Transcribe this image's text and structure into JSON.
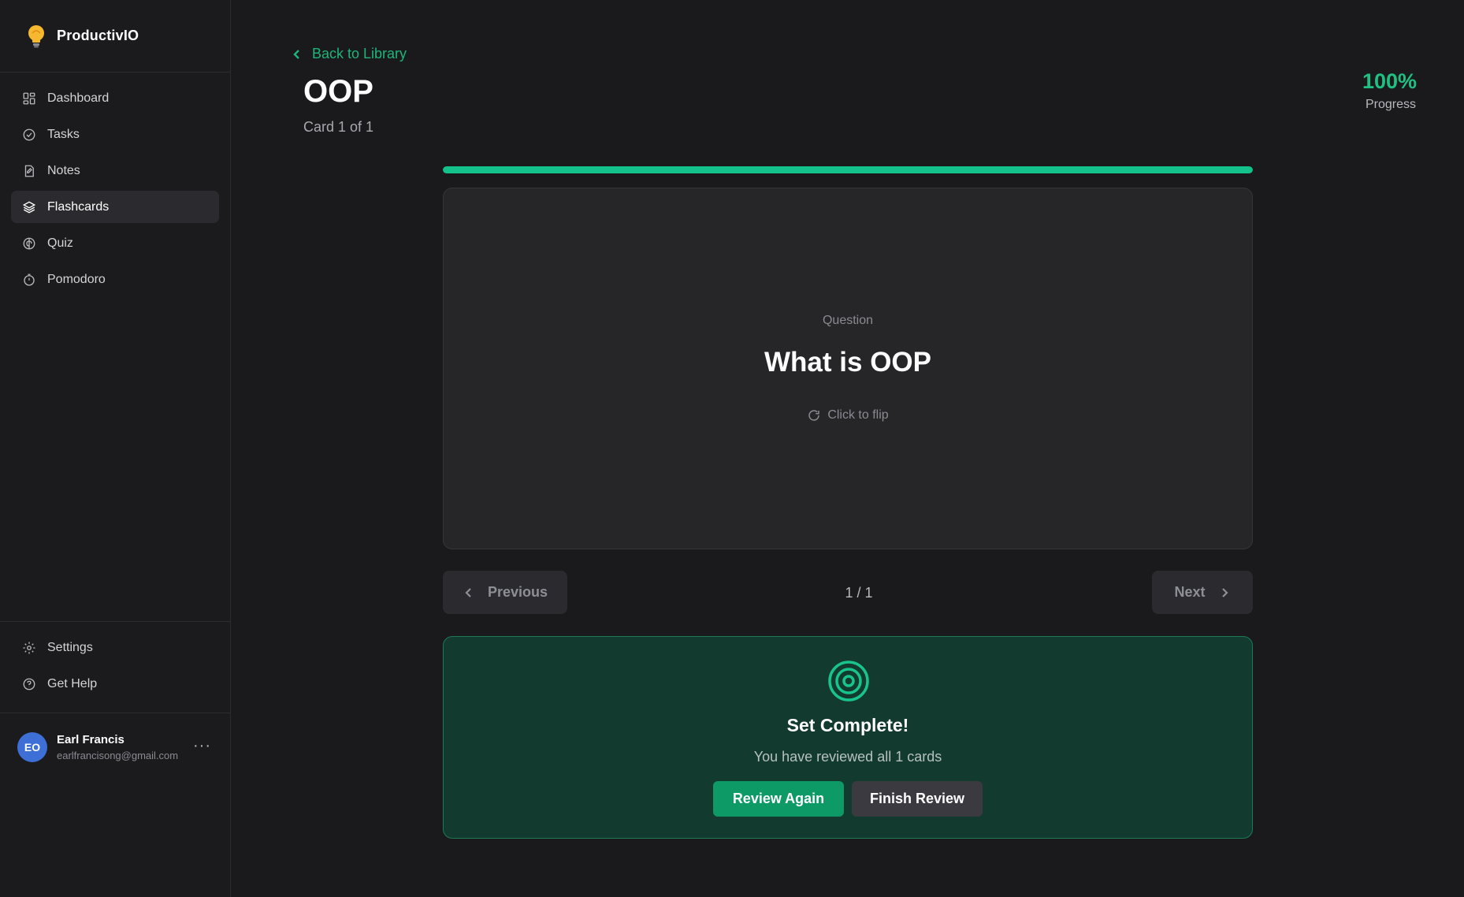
{
  "brand": {
    "name": "ProductivIO",
    "logo_icon": "lightbulb-icon"
  },
  "sidebar": {
    "items": [
      {
        "label": "Dashboard",
        "icon": "dashboard-grid-icon",
        "active": false
      },
      {
        "label": "Tasks",
        "icon": "check-circle-icon",
        "active": false
      },
      {
        "label": "Notes",
        "icon": "notes-icon",
        "active": false
      },
      {
        "label": "Flashcards",
        "icon": "layers-icon",
        "active": true
      },
      {
        "label": "Quiz",
        "icon": "brain-icon",
        "active": false
      },
      {
        "label": "Pomodoro",
        "icon": "timer-icon",
        "active": false
      }
    ],
    "footer": [
      {
        "label": "Settings",
        "icon": "gear-icon"
      },
      {
        "label": "Get Help",
        "icon": "help-circle-icon"
      }
    ]
  },
  "user": {
    "initials": "EO",
    "name": "Earl Francis",
    "email": "earlfrancisong@gmail.com",
    "more": "···"
  },
  "header": {
    "back_label": "Back to Library",
    "deck_title": "OOP",
    "card_count": "Card 1 of 1",
    "progress_value": "100%",
    "progress_label": "Progress"
  },
  "progress": {
    "fraction": 1.0
  },
  "flashcard": {
    "side_label": "Question",
    "question": "What is OOP",
    "hint": "Click to flip"
  },
  "navigation": {
    "previous_label": "Previous",
    "next_label": "Next",
    "pager": "1 / 1"
  },
  "completion": {
    "title": "Set Complete!",
    "subtitle": "You have reviewed all 1 cards",
    "review_again_label": "Review Again",
    "finish_label": "Finish Review"
  },
  "colors": {
    "accent": "#13c28b",
    "background": "#1a1a1c",
    "card": "#262628",
    "complete_bg": "#133a2e"
  }
}
